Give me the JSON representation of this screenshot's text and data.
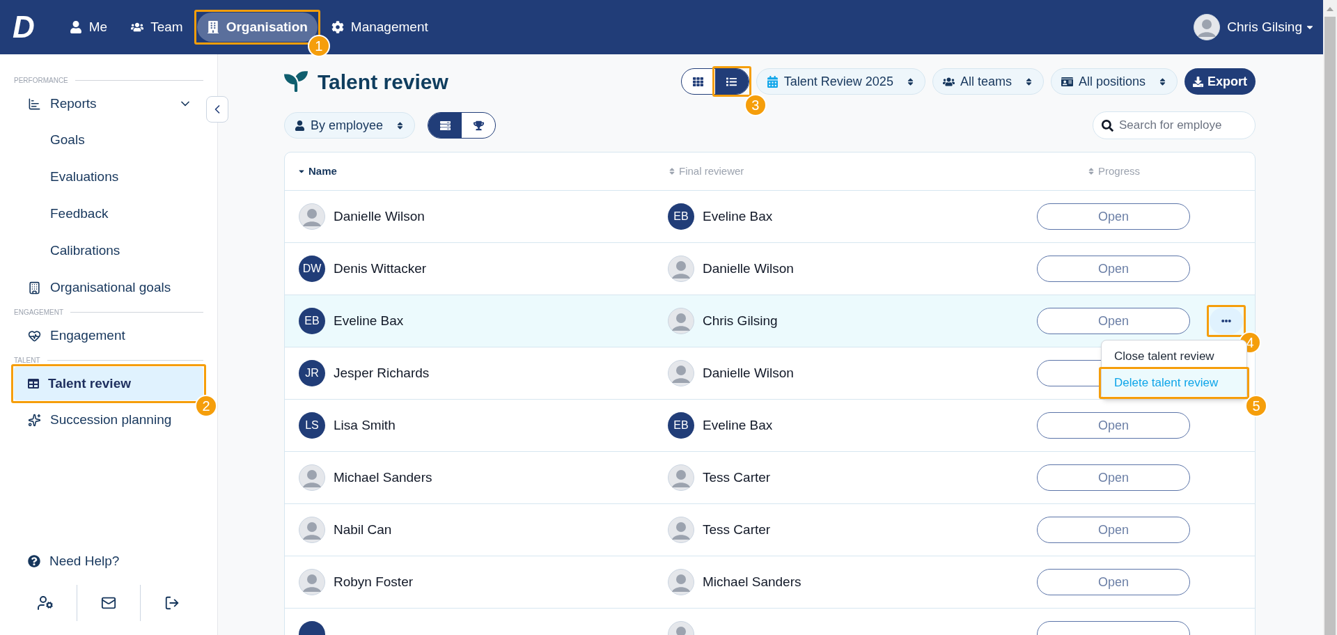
{
  "logo": "D",
  "nav": [
    {
      "label": "Me",
      "selected": false
    },
    {
      "label": "Team",
      "selected": false
    },
    {
      "label": "Organisation",
      "selected": true,
      "callout": "1"
    },
    {
      "label": "Management",
      "selected": false
    }
  ],
  "user": {
    "name": "Chris Gilsing"
  },
  "sidebar": {
    "sections": [
      {
        "title": "PERFORMANCE",
        "items": [
          {
            "label": "Reports",
            "selected": false,
            "expanded": true,
            "children": [
              {
                "label": "Goals",
                "selected": false
              },
              {
                "label": "Evaluations",
                "selected": false
              },
              {
                "label": "Feedback",
                "selected": false
              },
              {
                "label": "Calibrations",
                "selected": false
              }
            ]
          },
          {
            "label": "Organisational goals",
            "selected": false
          }
        ]
      },
      {
        "title": "ENGAGEMENT",
        "items": [
          {
            "label": "Engagement",
            "selected": false
          }
        ]
      },
      {
        "title": "TALENT",
        "items": [
          {
            "label": "Talent review",
            "selected": true,
            "callout": "2"
          },
          {
            "label": "Succession planning",
            "selected": false
          }
        ]
      }
    ],
    "help": "Need Help?"
  },
  "page": {
    "title": "Talent review",
    "view_toggle": [
      {
        "selected": false
      },
      {
        "selected": true,
        "callout": "3"
      }
    ],
    "filters": [
      "Talent Review 2025",
      "All teams",
      "All positions"
    ],
    "export": "Export",
    "group_by": "By employee",
    "mode_toggle": [
      {
        "selected": true
      },
      {
        "selected": false
      }
    ],
    "search": {
      "placeholder": "Search for employe"
    }
  },
  "table": {
    "columns": [
      {
        "label": "Name",
        "sorted": true
      },
      {
        "label": "Final reviewer",
        "sorted": false
      },
      {
        "label": "Progress",
        "sorted": false
      }
    ],
    "rows": [
      {
        "name": "Danielle Wilson",
        "avatar": {
          "kind": "photo"
        },
        "reviewer": "Eveline Bax",
        "reviewer_avatar": {
          "kind": "initials",
          "text": "EB"
        },
        "progress": "Open",
        "selected": false
      },
      {
        "name": "Denis Wittacker",
        "avatar": {
          "kind": "initials",
          "text": "DW"
        },
        "reviewer": "Danielle Wilson",
        "reviewer_avatar": {
          "kind": "photo"
        },
        "progress": "Open",
        "selected": false
      },
      {
        "name": "Eveline Bax",
        "avatar": {
          "kind": "initials",
          "text": "EB"
        },
        "reviewer": "Chris Gilsing",
        "reviewer_avatar": {
          "kind": "photo"
        },
        "progress": "Open",
        "selected": true,
        "actions": {
          "callout": "4",
          "menu": [
            {
              "label": "Close talent review",
              "selected": false
            },
            {
              "label": "Delete talent review",
              "selected": true,
              "callout": "5"
            }
          ]
        }
      },
      {
        "name": "Jesper Richards",
        "avatar": {
          "kind": "initials",
          "text": "JR"
        },
        "reviewer": "Danielle Wilson",
        "reviewer_avatar": {
          "kind": "photo"
        },
        "selected": false
      },
      {
        "name": "Lisa Smith",
        "avatar": {
          "kind": "initials",
          "text": "LS"
        },
        "reviewer": "Eveline Bax",
        "reviewer_avatar": {
          "kind": "initials",
          "text": "EB"
        },
        "progress": "Open",
        "selected": false
      },
      {
        "name": "Michael Sanders",
        "avatar": {
          "kind": "photo"
        },
        "reviewer": "Tess Carter",
        "reviewer_avatar": {
          "kind": "photo"
        },
        "progress": "Open",
        "selected": false
      },
      {
        "name": "Nabil Can",
        "avatar": {
          "kind": "photo"
        },
        "reviewer": "Tess Carter",
        "reviewer_avatar": {
          "kind": "photo"
        },
        "progress": "Open",
        "selected": false
      },
      {
        "name": "Robyn Foster",
        "avatar": {
          "kind": "photo"
        },
        "reviewer": "Michael Sanders",
        "reviewer_avatar": {
          "kind": "photo"
        },
        "progress": "Open",
        "selected": false
      }
    ]
  }
}
